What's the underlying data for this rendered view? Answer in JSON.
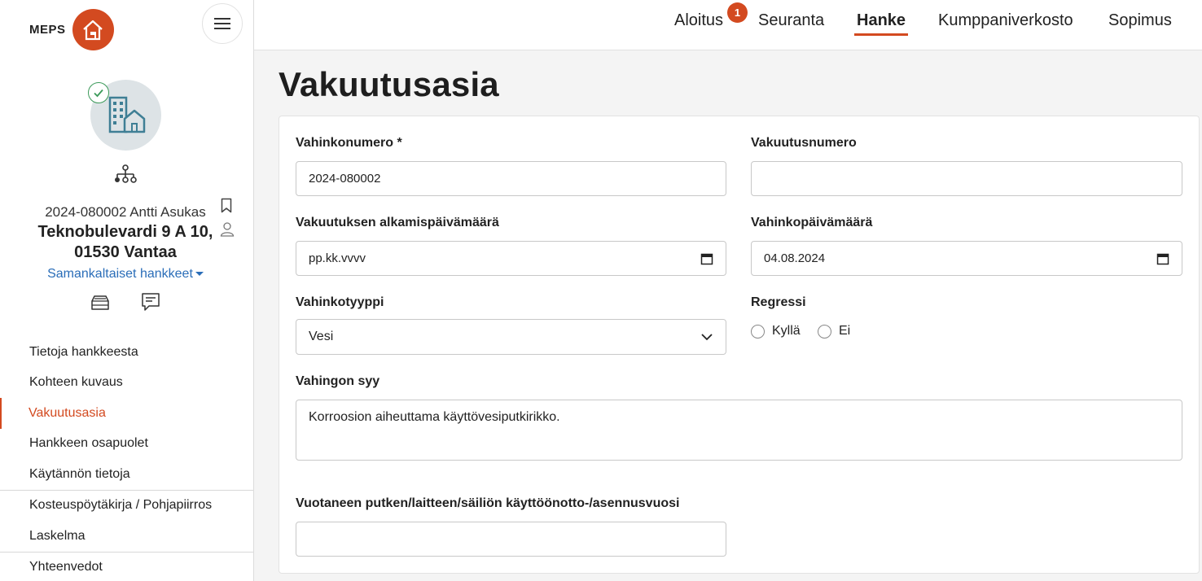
{
  "brand": {
    "name": "MEPS"
  },
  "project": {
    "id_name": "2024-080002 Antti Asukas",
    "address": "Teknobulevardi 9 A 10, 01530 Vantaa",
    "similar_link": "Samankaltaiset hankkeet"
  },
  "sidebar": {
    "items": [
      {
        "label": "Tietoja hankkeesta"
      },
      {
        "label": "Kohteen kuvaus"
      },
      {
        "label": "Vakuutusasia"
      },
      {
        "label": "Hankkeen osapuolet"
      },
      {
        "label": "Käytännön tietoja"
      },
      {
        "label": "Kosteuspöytäkirja / Pohjapiirros"
      },
      {
        "label": "Laskelma"
      },
      {
        "label": "Yhteenvedot"
      }
    ]
  },
  "topnav": {
    "tabs": [
      {
        "label": "Aloitus"
      },
      {
        "label": "Seuranta"
      },
      {
        "label": "Hanke"
      },
      {
        "label": "Kumppaniverkosto"
      },
      {
        "label": "Sopimus"
      }
    ],
    "notification_count": "1"
  },
  "page": {
    "title": "Vakuutusasia"
  },
  "form": {
    "claim_number": {
      "label": "Vahinkonumero *",
      "value": "2024-080002"
    },
    "policy_number": {
      "label": "Vakuutusnumero",
      "value": ""
    },
    "policy_start": {
      "label": "Vakuutuksen alkamispäivämäärä",
      "value": "pp.kk.vvvv"
    },
    "damage_date": {
      "label": "Vahinkopäivämäärä",
      "value": "04.08.2024"
    },
    "damage_type": {
      "label": "Vahinkotyyppi",
      "value": "Vesi"
    },
    "regress": {
      "label": "Regressi",
      "options": [
        "Kyllä",
        "Ei"
      ]
    },
    "damage_cause": {
      "label": "Vahingon syy",
      "value": "Korroosion aiheuttama käyttövesiputkirikko."
    },
    "install_year": {
      "label": "Vuotaneen putken/laitteen/säiliön käyttöönotto-/asennusvuosi",
      "value": ""
    }
  },
  "colors": {
    "accent": "#d34a20",
    "link": "#2a6db8",
    "success": "#3c9a5a"
  }
}
